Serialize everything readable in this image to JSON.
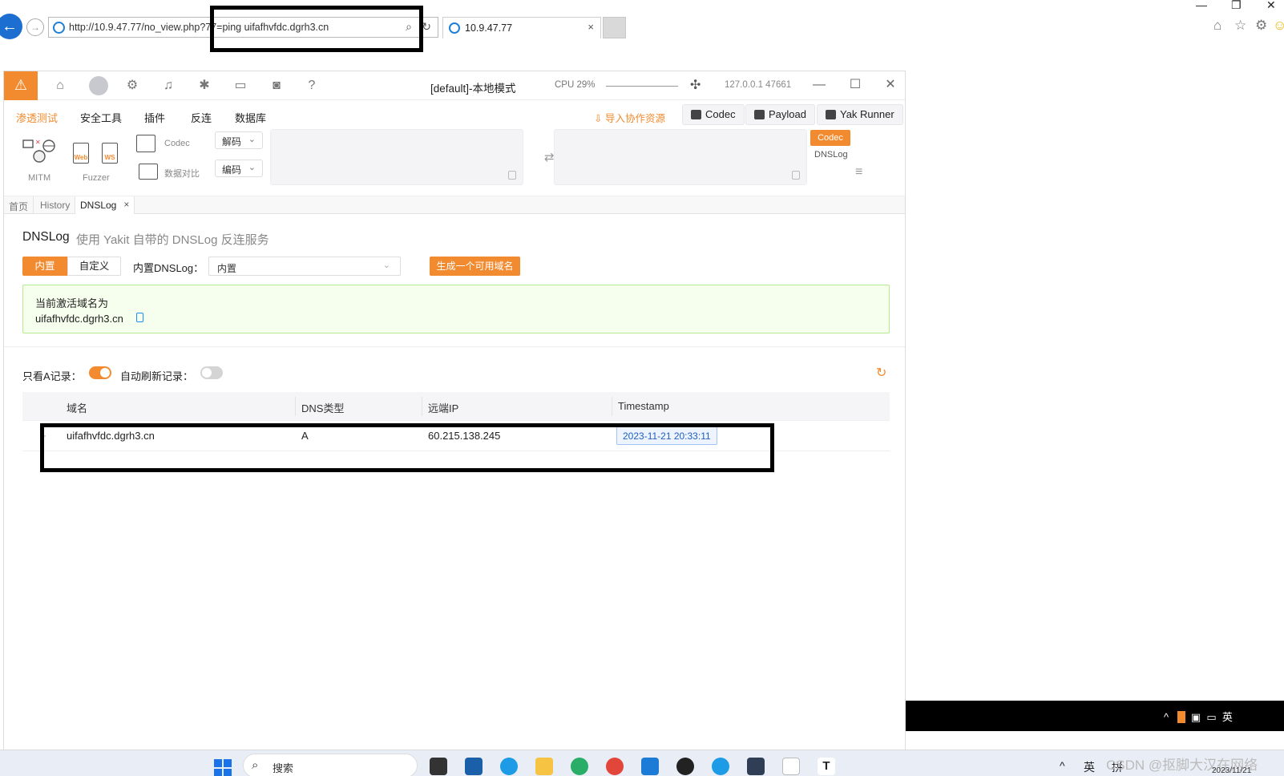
{
  "browser": {
    "address": "http://10.9.47.77/no_view.php?77=ping uifafhvfdc.dgrh3.cn",
    "tab_title": "10.9.47.77",
    "tab_close": "×",
    "search_glyph": "⌕",
    "refresh_glyph": "↻"
  },
  "yakit": {
    "window_title": "[default]-本地模式",
    "cpu": "CPU 29%",
    "ip_port": "127.0.0.1 47661",
    "menu": [
      "渗透测试",
      "安全工具",
      "插件",
      "反连",
      "数据库"
    ],
    "import_label": "导入协作资源",
    "top_buttons": [
      "Codec",
      "Payload",
      "Yak Runner"
    ],
    "tools": {
      "mitm": "MITM",
      "fuzzer": "Fuzzer",
      "web_badge": "Web",
      "ws_badge": "WS",
      "codec": "Codec",
      "compare": "数据对比",
      "decode": "解码",
      "encode": "编码"
    },
    "side_tabs": [
      "Codec",
      "DNSLog"
    ],
    "page_tabs": [
      "首页",
      "History",
      "DNSLog"
    ],
    "dnslog": {
      "title": "DNSLog",
      "subtitle": "使用 Yakit 自带的 DNSLog 反连服务",
      "mode_builtin": "内置",
      "mode_custom": "自定义",
      "builtin_label": "内置DNSLog：",
      "builtin_value": "内置",
      "generate_button": "生成一个可用域名",
      "active_label": "当前激活域名为",
      "active_domain": "uifafhvfdc.dgrh3.cn",
      "a_only_label": "只看A记录：",
      "auto_refresh_label": "自动刷新记录：",
      "a_only_on": true,
      "auto_refresh_on": false,
      "columns": [
        "域名",
        "DNS类型",
        "远端IP",
        "Timestamp"
      ],
      "rows": [
        {
          "domain": "uifafhvfdc.dgrh3.cn",
          "type": "A",
          "ip": "60.215.138.245",
          "timestamp": "2023-11-21 20:33:11"
        }
      ]
    }
  },
  "taskbar": {
    "search": "搜索",
    "ime": [
      "英",
      "拼"
    ],
    "watermark": "CSDN @抠脚大汉在网络",
    "date": "2023/11/21"
  },
  "colors": {
    "accent": "#f28b30",
    "success_bg": "#f6ffed",
    "success_border": "#b7eb8f"
  }
}
